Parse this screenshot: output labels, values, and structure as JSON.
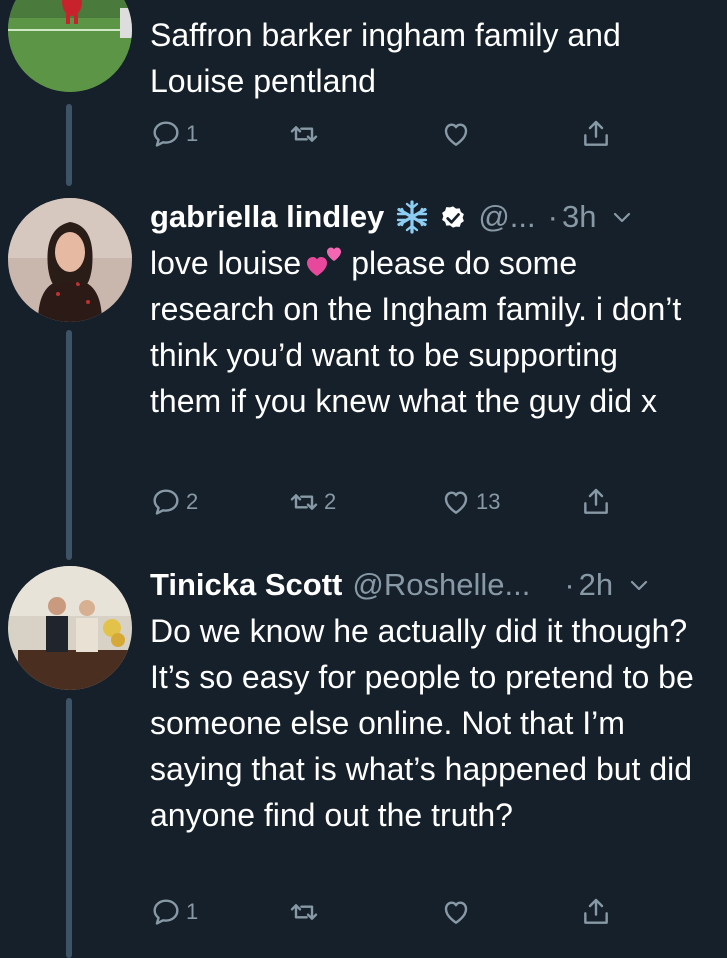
{
  "tweets": [
    {
      "text": "Saffron barker ingham family and Louise pentland",
      "replies": "1",
      "retweets": "",
      "likes": ""
    },
    {
      "name": "gabriella lindley",
      "handle": "@...",
      "dot": "·",
      "time": "3h",
      "text_before": "love louise",
      "text_after": "please do some research on the Ingham family. i don’t think you’d want to be supporting them if you knew what the guy did x",
      "replies": "2",
      "retweets": "2",
      "likes": "13"
    },
    {
      "name": "Tinicka Scott",
      "handle": "@Roshelle...",
      "dot": "·",
      "time": "2h",
      "text": "Do we know he actually did it though? It’s so easy for people to pretend to be someone else online. Not that I’m saying that is what’s happened but did anyone find out the truth?",
      "replies": "1",
      "retweets": "",
      "likes": ""
    }
  ],
  "icons": {
    "reply": "reply-icon",
    "retweet": "retweet-icon",
    "like": "heart-icon",
    "share": "share-icon",
    "verified": "verified-badge-icon",
    "snowflake": "snowflake-icon",
    "two-hearts": "two-hearts-emoji"
  },
  "colors": {
    "background": "#15202b",
    "secondary_text": "#8899a6",
    "thread_line": "#3d5466"
  }
}
